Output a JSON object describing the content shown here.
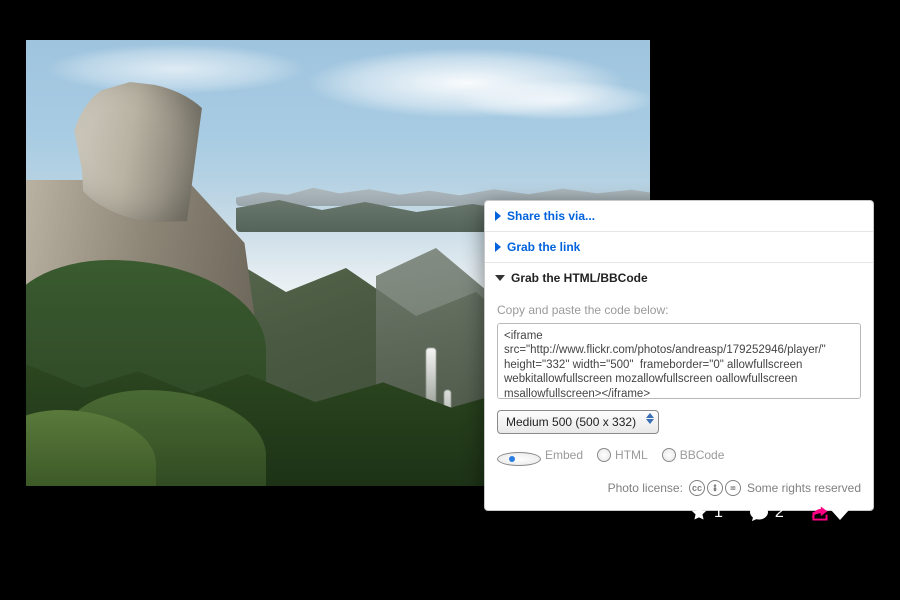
{
  "panel": {
    "share_via_label": "Share this via...",
    "grab_link_label": "Grab the link",
    "grab_html_label": "Grab the HTML/BBCode",
    "copy_hint": "Copy and paste the code below:",
    "embed_code": "<iframe src=\"http://www.flickr.com/photos/andreasp/179252946/player/\" height=\"332\" width=\"500\"  frameborder=\"0\" allowfullscreen webkitallowfullscreen mozallowfullscreen oallowfullscreen msallowfullscreen></iframe>",
    "size_selected": "Medium 500 (500 x 332)",
    "format": {
      "embed": "Embed",
      "html": "HTML",
      "bbcode": "BBCode"
    },
    "license_prefix": "Photo license:",
    "license_text": "Some rights reserved"
  },
  "actions": {
    "fav_count": "1",
    "comment_count": "2"
  },
  "colors": {
    "accent_pink": "#ff0084",
    "flickr_blue": "#0063dc"
  }
}
